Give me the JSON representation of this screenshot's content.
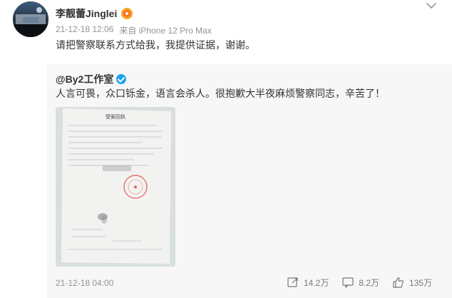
{
  "post": {
    "author": "李靓蕾Jinglei",
    "time": "21-12-18 12:06",
    "source": "来自 iPhone 12 Pro Max",
    "text": "请把警察联系方式给我，我提供证据，谢谢。"
  },
  "repost": {
    "author": "@By2工作室",
    "text": "人言可畏，众口铄金，语言会杀人。很抱歉大半夜麻烦警察同志，辛苦了！",
    "date": "21-12-18 04:00",
    "shares": "14.2万",
    "comments": "8.2万",
    "likes": "135万",
    "document_title": "受案回执"
  }
}
